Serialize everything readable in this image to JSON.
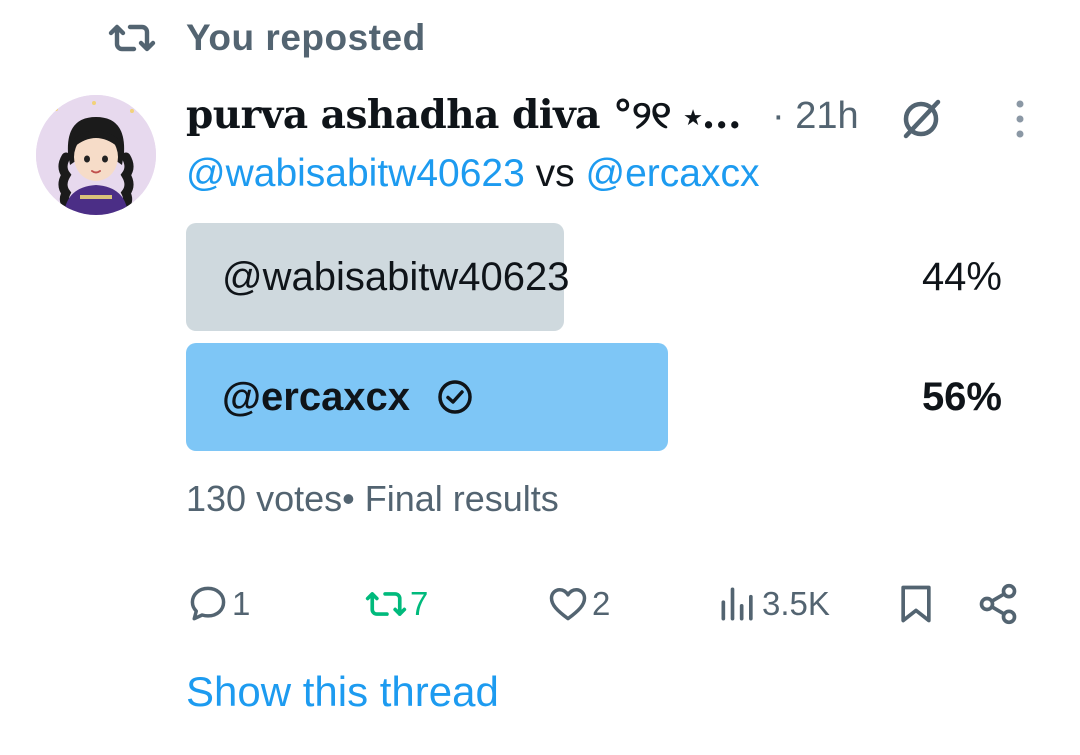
{
  "repost_context": {
    "text": "You reposted"
  },
  "tweet": {
    "display_name": "purva ashadha diva °୨୧ ⋆...",
    "time": "· 21h",
    "handle_a": "@wabisabitw40623",
    "vs_text": "vs",
    "handle_b": "@ercaxcx"
  },
  "poll": {
    "options": [
      {
        "label": "@wabisabitw40623",
        "percent": "44%",
        "fraction": 0.44,
        "winner": false
      },
      {
        "label": "@ercaxcx",
        "percent": "56%",
        "fraction": 0.56,
        "winner": true
      }
    ],
    "summary": "130 votes• Final results"
  },
  "actions": {
    "replies": "1",
    "reposts": "7",
    "likes": "2",
    "views": "3.5K"
  },
  "show_thread": "Show this thread",
  "colors": {
    "accent": "#1d9bf0",
    "repost_green": "#00ba7c",
    "muted": "#536471",
    "poll_loser": "#cfd9de",
    "poll_winner": "#7ec6f6"
  }
}
